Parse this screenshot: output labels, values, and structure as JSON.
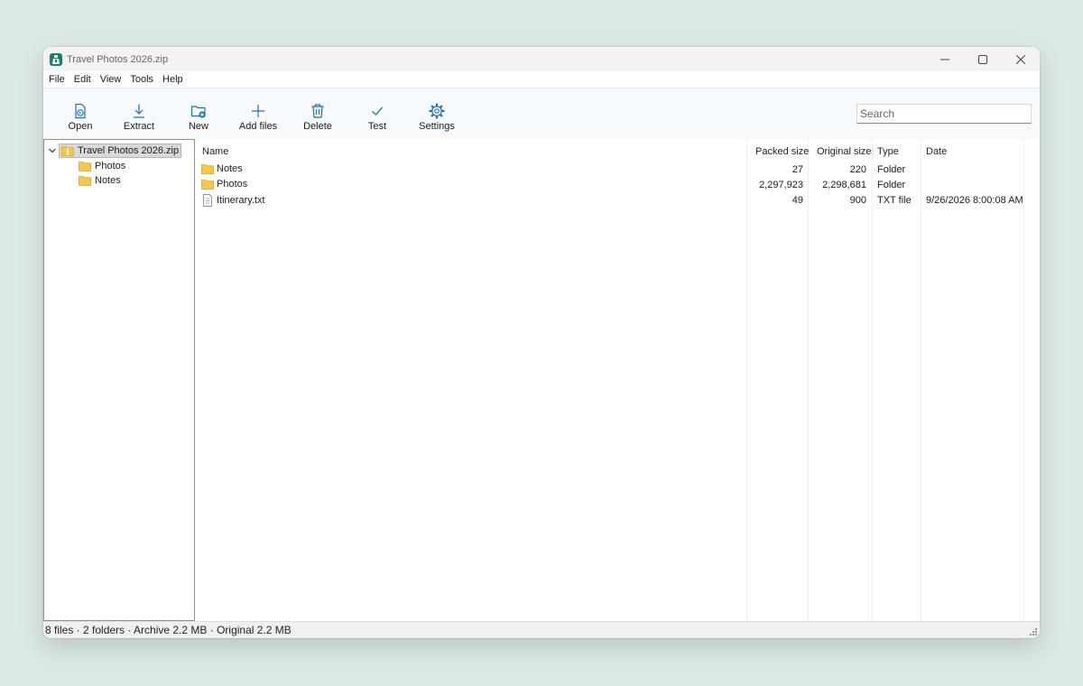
{
  "window": {
    "title": "Travel Photos 2026.zip"
  },
  "menu": [
    "File",
    "Edit",
    "View",
    "Tools",
    "Help"
  ],
  "toolbar": {
    "open": "Open",
    "extract": "Extract",
    "new": "New",
    "add_files": "Add files",
    "delete": "Delete",
    "test": "Test",
    "settings": "Settings"
  },
  "search": {
    "placeholder": "Search",
    "value": ""
  },
  "tree": {
    "root": "Travel Photos 2026.zip",
    "children": [
      "Photos",
      "Notes"
    ]
  },
  "list": {
    "columns": {
      "name": "Name",
      "packed": "Packed size",
      "original": "Original size",
      "type": "Type",
      "date": "Date"
    },
    "rows": [
      {
        "icon": "folder-icon",
        "name": "Notes",
        "packed": "27",
        "original": "220",
        "type": "Folder",
        "date": ""
      },
      {
        "icon": "folder-icon",
        "name": "Photos",
        "packed": "2,297,923",
        "original": "2,298,681",
        "type": "Folder",
        "date": ""
      },
      {
        "icon": "text-file-icon",
        "name": "Itinerary.txt",
        "packed": "49",
        "original": "900",
        "type": "TXT file",
        "date": "9/26/2026 8:00:08 AM"
      }
    ]
  },
  "status": {
    "text": "8 files · 2 folders · Archive 2.2 MB · Original 2.2 MB"
  },
  "colors": {
    "accent": "#1f6fb8",
    "folder": "#f7c74a",
    "app_icon": "#15806f"
  }
}
